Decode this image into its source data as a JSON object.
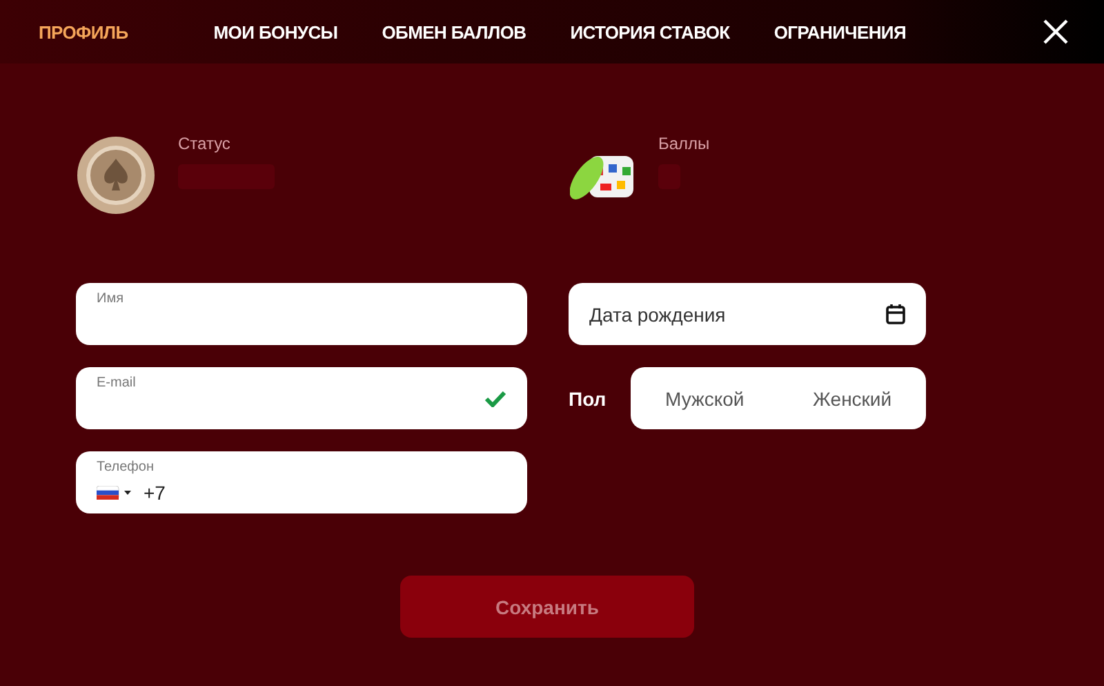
{
  "tabs": [
    {
      "label": "ПРОФИЛЬ",
      "selected": true
    },
    {
      "label": "МОИ БОНУСЫ",
      "selected": false
    },
    {
      "label": "ОБМЕН БАЛЛОВ",
      "selected": false
    },
    {
      "label": "ИСТОРИЯ СТАВОК",
      "selected": false
    },
    {
      "label": "ОГРАНИЧЕНИЯ",
      "selected": false
    }
  ],
  "status": {
    "label": "Статус"
  },
  "points": {
    "label": "Баллы"
  },
  "name_field": {
    "label": "Имя"
  },
  "email_field": {
    "label": "E-mail",
    "valid": true
  },
  "phone_field": {
    "label": "Телефон",
    "value": "+7"
  },
  "birthdate_field": {
    "placeholder": "Дата рождения"
  },
  "gender": {
    "label": "Пол",
    "options": [
      {
        "label": "Мужской",
        "selected": false
      },
      {
        "label": "Женский",
        "selected": false
      }
    ]
  },
  "save_button": {
    "label": "Сохранить",
    "disabled": true
  }
}
